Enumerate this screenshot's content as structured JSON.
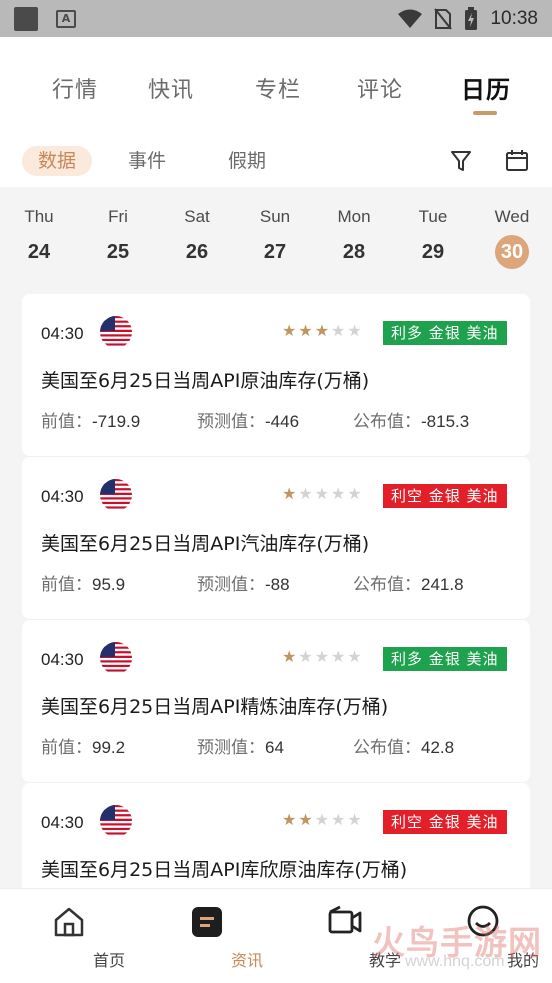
{
  "status_bar": {
    "time": "10:38"
  },
  "main_tabs": [
    {
      "label": "行情"
    },
    {
      "label": "快讯"
    },
    {
      "label": "专栏"
    },
    {
      "label": "评论"
    },
    {
      "label": "日历"
    }
  ],
  "sub_tabs": [
    {
      "label": "数据"
    },
    {
      "label": "事件"
    },
    {
      "label": "假期"
    }
  ],
  "week": [
    {
      "name": "Thu",
      "num": "24"
    },
    {
      "name": "Fri",
      "num": "25"
    },
    {
      "name": "Sat",
      "num": "26"
    },
    {
      "name": "Sun",
      "num": "27"
    },
    {
      "name": "Mon",
      "num": "28"
    },
    {
      "name": "Tue",
      "num": "29"
    },
    {
      "name": "Wed",
      "num": "30"
    }
  ],
  "labels": {
    "prev": "前值：",
    "forecast": "预测值：",
    "actual": "公布值："
  },
  "events": [
    {
      "time": "04:30",
      "stars": 3,
      "badge": "利多 金银 美油",
      "badge_type": "good",
      "title": "美国至6月25日当周API原油库存(万桶)",
      "prev": "-719.9",
      "forecast": "-446",
      "actual": "-815.3"
    },
    {
      "time": "04:30",
      "stars": 1,
      "badge": "利空 金银 美油",
      "badge_type": "bad",
      "title": "美国至6月25日当周API汽油库存(万桶)",
      "prev": "95.9",
      "forecast": "-88",
      "actual": "241.8"
    },
    {
      "time": "04:30",
      "stars": 1,
      "badge": "利多 金银 美油",
      "badge_type": "good",
      "title": "美国至6月25日当周API精炼油库存(万桶)",
      "prev": "99.2",
      "forecast": "64",
      "actual": "42.8"
    },
    {
      "time": "04:30",
      "stars": 2,
      "badge": "利空 金银 美油",
      "badge_type": "bad",
      "title": "美国至6月25日当周API库欣原油库存(万桶)",
      "prev": "",
      "forecast": "",
      "actual": ""
    }
  ],
  "bottom_nav": [
    {
      "label": "首页",
      "icon": "home-icon"
    },
    {
      "label": "资讯",
      "icon": "news-icon"
    },
    {
      "label": "教学",
      "icon": "video-icon"
    },
    {
      "label": "我的",
      "icon": "chat-face-icon"
    }
  ],
  "watermark": {
    "text": "火鸟手游网",
    "sub": "www.hnq.com"
  },
  "colors": {
    "accent": "#c8895a",
    "good": "#1fa24e",
    "bad": "#e3202a",
    "star": "#c29560"
  }
}
